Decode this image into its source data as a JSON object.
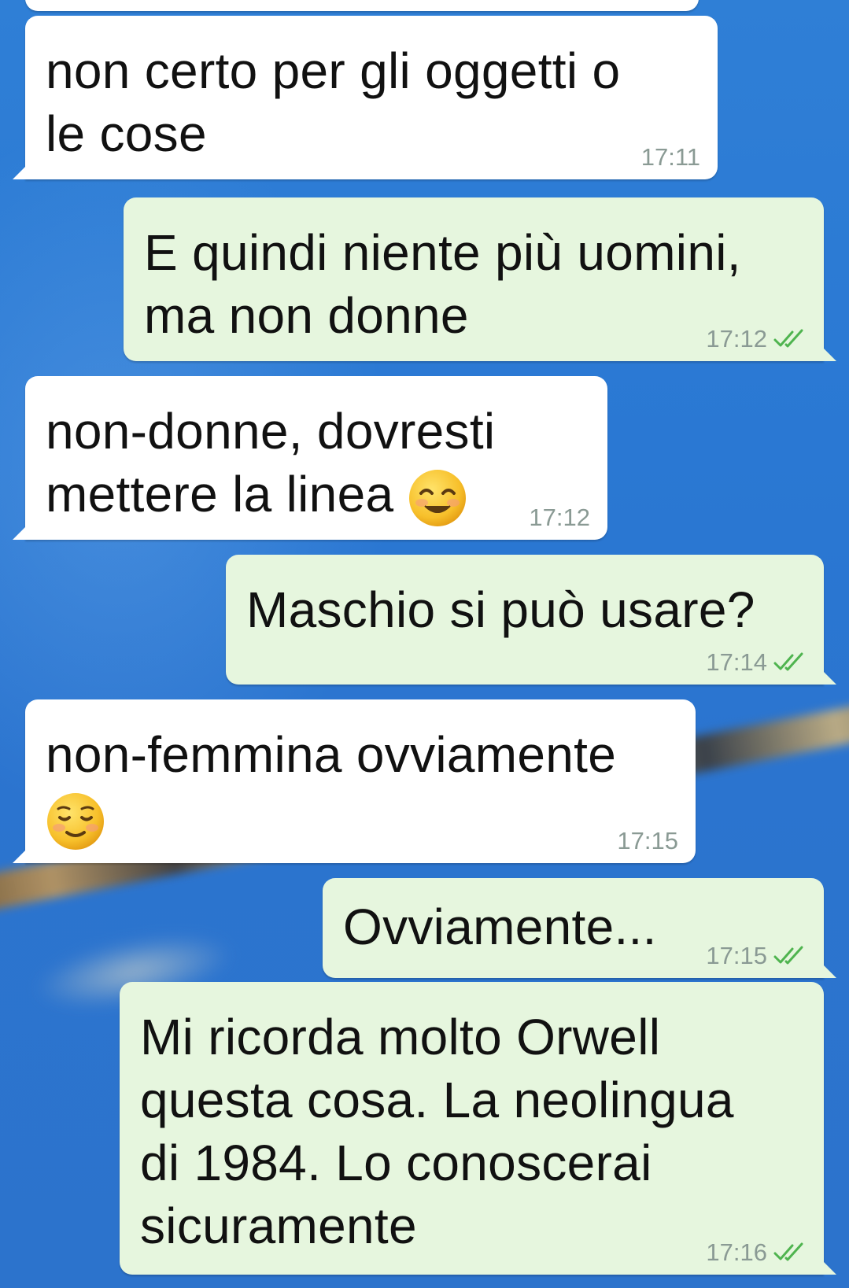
{
  "conversation": {
    "messages": [
      {
        "direction": "incoming",
        "line1": "non certo per gli oggetti o",
        "line2": "le cose",
        "time": "17:11"
      },
      {
        "direction": "outgoing",
        "line1": "E quindi niente più uomini,",
        "line2": "ma non donne",
        "time": "17:12",
        "status": "read"
      },
      {
        "direction": "incoming",
        "line1": "non-donne, dovresti",
        "line2": "mettere la linea",
        "emoji": "smiling-face-with-smiling-eyes",
        "time": "17:12"
      },
      {
        "direction": "outgoing",
        "line1": "Maschio si può usare?",
        "time": "17:14",
        "status": "read"
      },
      {
        "direction": "incoming",
        "line1": "non-femmina ovviamente",
        "emoji": "smiling-face",
        "time": "17:15"
      },
      {
        "direction": "outgoing",
        "line1": "Ovviamente...",
        "time": "17:15",
        "status": "read"
      },
      {
        "direction": "outgoing",
        "line1": "Mi ricorda molto Orwell",
        "line2": "questa cosa. La neolingua",
        "line3": "di 1984. Lo conoscerai",
        "line4": "sicuramente",
        "time": "17:16",
        "status": "read"
      }
    ]
  },
  "colors": {
    "incoming_bubble": "#ffffff",
    "outgoing_bubble": "#e6f6de",
    "timestamp": "#8a9a94",
    "read_ticks": "#4fb44f",
    "wallpaper": "#2b78d3"
  }
}
